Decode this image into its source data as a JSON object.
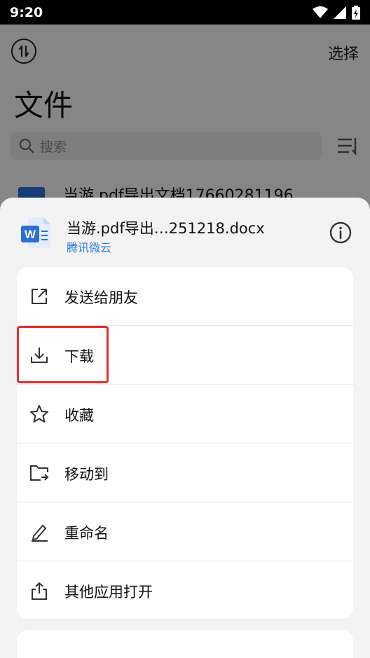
{
  "status_bar": {
    "time": "9:20",
    "icons": [
      "wifi-icon",
      "signal-icon",
      "battery-icon"
    ]
  },
  "header": {
    "select_label": "选择",
    "title": "文件",
    "search_placeholder": "搜索"
  },
  "background_file": {
    "name": "当游.pdf导出文档17660281196"
  },
  "sheet": {
    "file_name": "当游.pdf导出…251218.docx",
    "source": "腾讯微云",
    "menu": [
      {
        "label": "发送给朋友",
        "icon": "share-out-icon"
      },
      {
        "label": "下载",
        "icon": "download-icon"
      },
      {
        "label": "收藏",
        "icon": "star-icon"
      },
      {
        "label": "移动到",
        "icon": "move-folder-icon"
      },
      {
        "label": "重命名",
        "icon": "rename-pencil-icon"
      },
      {
        "label": "其他应用打开",
        "icon": "open-with-icon"
      }
    ]
  },
  "colors": {
    "accent_blue": "#2f7be5",
    "highlight_red": "#e0302b",
    "word_blue": "#2b6fd6"
  }
}
